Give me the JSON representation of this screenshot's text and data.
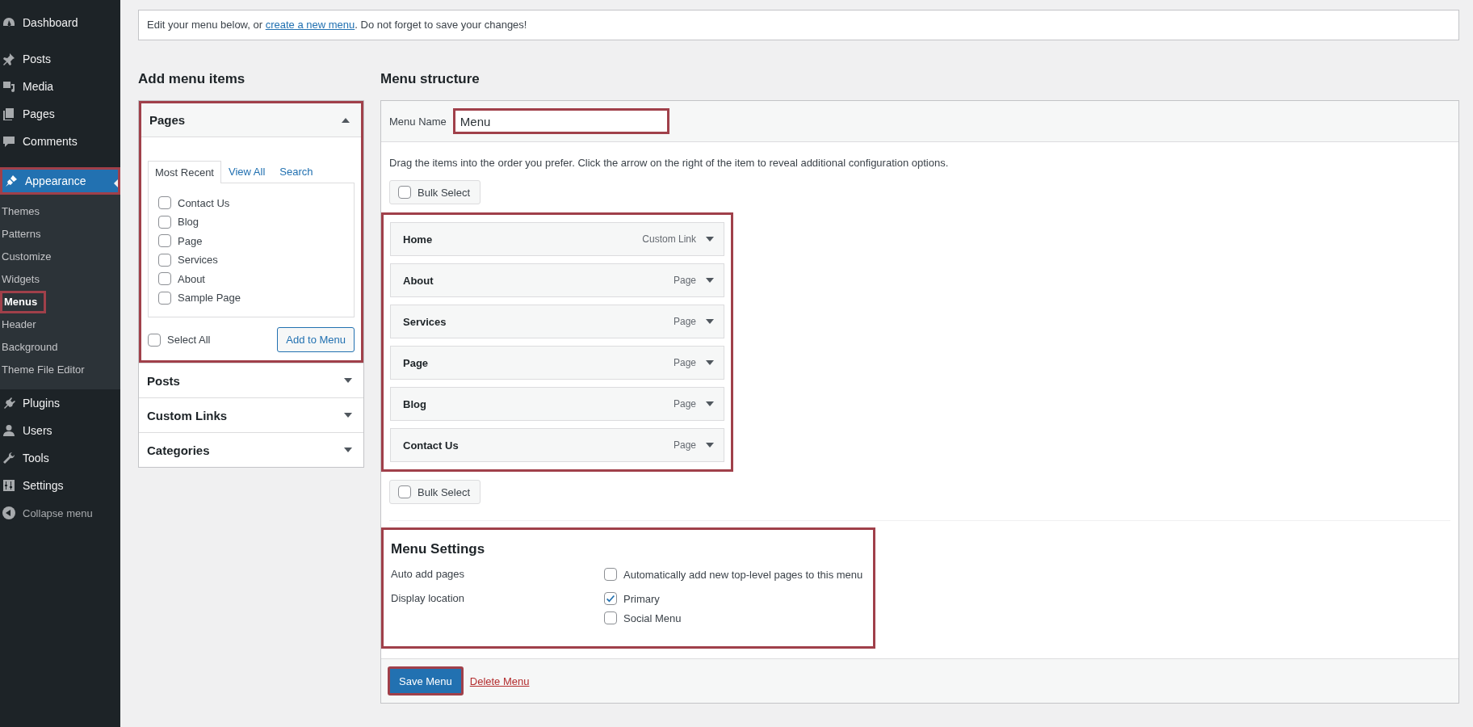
{
  "sidebar": {
    "items": [
      {
        "label": "Dashboard",
        "selected": false,
        "highlighted": false
      },
      {
        "label": "Posts",
        "selected": false,
        "highlighted": false
      },
      {
        "label": "Media",
        "selected": false,
        "highlighted": false
      },
      {
        "label": "Pages",
        "selected": false,
        "highlighted": false
      },
      {
        "label": "Comments",
        "selected": false,
        "highlighted": false
      },
      {
        "label": "Appearance",
        "selected": true,
        "highlighted": true,
        "children": [
          {
            "label": "Themes",
            "selected": false,
            "highlighted": false
          },
          {
            "label": "Patterns",
            "selected": false,
            "highlighted": false
          },
          {
            "label": "Customize",
            "selected": false,
            "highlighted": false
          },
          {
            "label": "Widgets",
            "selected": false,
            "highlighted": false
          },
          {
            "label": "Menus",
            "selected": true,
            "highlighted": true
          },
          {
            "label": "Header",
            "selected": false,
            "highlighted": false
          },
          {
            "label": "Background",
            "selected": false,
            "highlighted": false
          },
          {
            "label": "Theme File Editor",
            "selected": false,
            "highlighted": false
          }
        ]
      },
      {
        "label": "Plugins",
        "selected": false,
        "highlighted": false
      },
      {
        "label": "Users",
        "selected": false,
        "highlighted": false
      },
      {
        "label": "Tools",
        "selected": false,
        "highlighted": false
      },
      {
        "label": "Settings",
        "selected": false,
        "highlighted": false
      }
    ],
    "collapse": {
      "label": "Collapse menu"
    }
  },
  "notice": {
    "before": "Edit your menu below, or ",
    "link": "create a new menu",
    "after": ". Do not forget to save your changes!"
  },
  "add_menu_items": {
    "title": "Add menu items",
    "sections": [
      {
        "title": "Pages",
        "expanded": true,
        "highlighted": true,
        "tabs": [
          {
            "label": "Most Recent",
            "selected": true
          },
          {
            "label": "View All",
            "selected": false
          },
          {
            "label": "Search",
            "selected": false
          }
        ],
        "items": [
          {
            "label": "Contact Us",
            "checked": false
          },
          {
            "label": "Blog",
            "checked": false
          },
          {
            "label": "Page",
            "checked": false
          },
          {
            "label": "Services",
            "checked": false
          },
          {
            "label": "About",
            "checked": false
          },
          {
            "label": "Sample Page",
            "checked": false
          }
        ],
        "select_all": {
          "label": "Select All",
          "checked": false
        },
        "add_button": "Add to Menu"
      },
      {
        "title": "Posts",
        "expanded": false,
        "highlighted": false
      },
      {
        "title": "Custom Links",
        "expanded": false,
        "highlighted": false
      },
      {
        "title": "Categories",
        "expanded": false,
        "highlighted": false
      }
    ]
  },
  "menu_structure": {
    "title": "Menu structure",
    "menu_name": {
      "label": "Menu Name",
      "value": "Menu",
      "highlighted": true
    },
    "instructions": "Drag the items into the order you prefer. Click the arrow on the right of the item to reveal additional configuration options.",
    "bulk_select_top": {
      "label": "Bulk Select",
      "checked": false
    },
    "items_highlighted": true,
    "items": [
      {
        "title": "Home",
        "type": "Custom Link"
      },
      {
        "title": "About",
        "type": "Page"
      },
      {
        "title": "Services",
        "type": "Page"
      },
      {
        "title": "Page",
        "type": "Page"
      },
      {
        "title": "Blog",
        "type": "Page"
      },
      {
        "title": "Contact Us",
        "type": "Page"
      }
    ],
    "bulk_select_bottom": {
      "label": "Bulk Select",
      "checked": false
    },
    "settings": {
      "title": "Menu Settings",
      "highlighted": true,
      "rows": [
        {
          "label": "Auto add pages",
          "options": [
            {
              "label": "Automatically add new top-level pages to this menu",
              "checked": false
            }
          ]
        },
        {
          "label": "Display location",
          "options": [
            {
              "label": "Primary",
              "checked": true
            },
            {
              "label": "Social Menu",
              "checked": false
            }
          ]
        }
      ]
    },
    "save_button": {
      "label": "Save Menu",
      "highlighted": true
    },
    "delete_link": "Delete Menu"
  }
}
